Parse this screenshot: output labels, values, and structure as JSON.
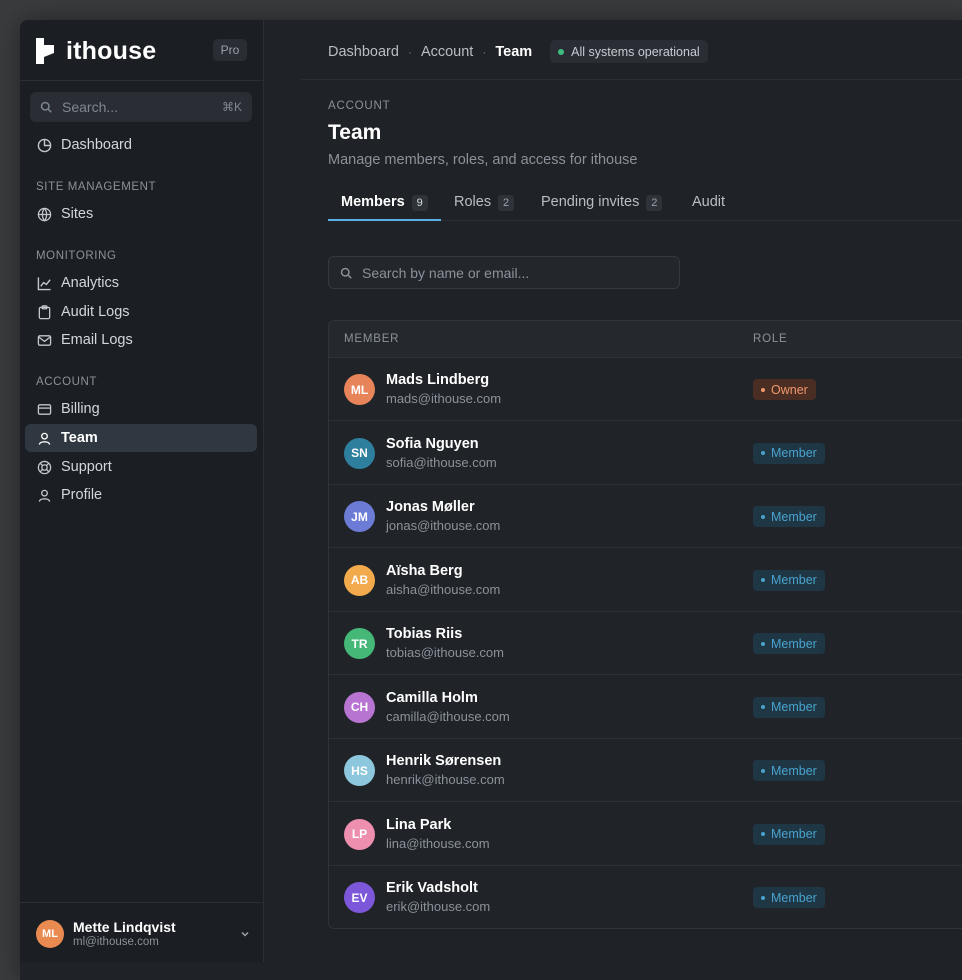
{
  "brand": {
    "name": "ithouse",
    "plan": "Pro"
  },
  "sidebar": {
    "search": {
      "placeholder": "Search...",
      "shortcut": "⌘K"
    },
    "items": [
      {
        "label": "Dashboard",
        "icon": "pie-chart-icon"
      },
      {
        "label": "Sites",
        "icon": "globe-icon"
      },
      {
        "label": "Analytics",
        "icon": "line-chart-icon"
      },
      {
        "label": "Audit Logs",
        "icon": "clipboard-icon"
      },
      {
        "label": "Email Logs",
        "icon": "mail-icon"
      },
      {
        "label": "Billing",
        "icon": "credit-card-icon"
      },
      {
        "label": "Team",
        "icon": "user-icon",
        "active": true
      },
      {
        "label": "Support",
        "icon": "lifebuoy-icon"
      },
      {
        "label": "Profile",
        "icon": "user-icon"
      }
    ],
    "sections": [
      "SITE MANAGEMENT",
      "MONITORING",
      "ACCOUNT"
    ],
    "user": {
      "initials": "ML",
      "name": "Mette Lindqvist",
      "email": "ml@ithouse.com"
    }
  },
  "breadcrumb": [
    "Dashboard",
    "Account",
    "Team"
  ],
  "status": {
    "text": "All systems operational",
    "color": "#3fbf7f"
  },
  "page": {
    "eyebrow": "ACCOUNT",
    "title": "Team",
    "subtitle": "Manage members, roles, and access for ithouse"
  },
  "tabs": [
    {
      "label": "Members",
      "count": "9",
      "active": true
    },
    {
      "label": "Roles",
      "count": "2"
    },
    {
      "label": "Pending invites",
      "count": "2"
    },
    {
      "label": "Audit",
      "count": ""
    }
  ],
  "member_search": {
    "placeholder": "Search by name or email..."
  },
  "table": {
    "columns": [
      "MEMBER",
      "ROLE"
    ],
    "rows": [
      {
        "initials": "ML",
        "name": "Mads Lindberg",
        "email": "mads@ithouse.com",
        "role": "Owner",
        "avatar_color": "#e8845a"
      },
      {
        "initials": "SN",
        "name": "Sofia Nguyen",
        "email": "sofia@ithouse.com",
        "role": "Member",
        "avatar_color": "#2e7f9e"
      },
      {
        "initials": "JM",
        "name": "Jonas Møller",
        "email": "jonas@ithouse.com",
        "role": "Member",
        "avatar_color": "#6c7bd6"
      },
      {
        "initials": "AB",
        "name": "Aïsha Berg",
        "email": "aisha@ithouse.com",
        "role": "Member",
        "avatar_color": "#f2aa4c"
      },
      {
        "initials": "TR",
        "name": "Tobias Riis",
        "email": "tobias@ithouse.com",
        "role": "Member",
        "avatar_color": "#45b878"
      },
      {
        "initials": "CH",
        "name": "Camilla Holm",
        "email": "camilla@ithouse.com",
        "role": "Member",
        "avatar_color": "#b774d1"
      },
      {
        "initials": "HS",
        "name": "Henrik Sørensen",
        "email": "henrik@ithouse.com",
        "role": "Member",
        "avatar_color": "#8cc7dd"
      },
      {
        "initials": "LP",
        "name": "Lina Park",
        "email": "lina@ithouse.com",
        "role": "Member",
        "avatar_color": "#ee8fb0"
      },
      {
        "initials": "EV",
        "name": "Erik Vadsholt",
        "email": "erik@ithouse.com",
        "role": "Member",
        "avatar_color": "#7c57d9"
      }
    ]
  }
}
